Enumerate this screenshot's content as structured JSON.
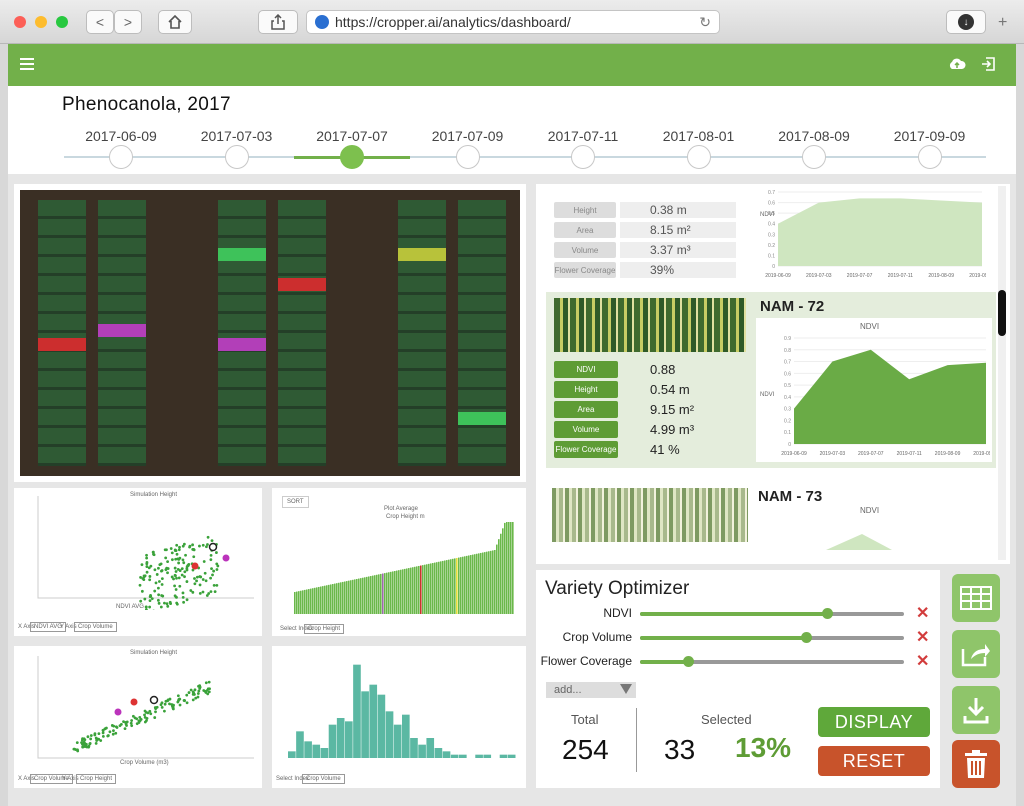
{
  "browser": {
    "url": "https://cropper.ai/analytics/dashboard/",
    "nav_back": "<",
    "nav_forward": ">",
    "home_icon": "home-icon",
    "share_icon": "share-icon",
    "download_icon": "download-icon",
    "new_tab": "+"
  },
  "app": {
    "menu_icon": "hamburger-icon",
    "upload_icon": "cloud-upload-icon",
    "logout_icon": "logout-icon",
    "title": "Phenocanola, 2017",
    "accent": "#72b04a",
    "dates": [
      "2017-06-09",
      "2017-07-03",
      "2017-07-07",
      "2017-07-09",
      "2017-07-11",
      "2017-08-01",
      "2017-08-09",
      "2017-09-09"
    ],
    "selected_date_index": 2
  },
  "nam_prev": {
    "metrics": [
      {
        "label": "Height",
        "value": "0.38 m"
      },
      {
        "label": "Area",
        "value": "8.15 m²"
      },
      {
        "label": "Volume",
        "value": "3.37 m³"
      },
      {
        "label": "Flower Coverage",
        "value": "39%"
      }
    ],
    "legend": "NDVI",
    "xticks": [
      "2019-06-09",
      "2019-07-03",
      "2019-07-07",
      "2019-07-11",
      "2019-08-09",
      "2019-09-09"
    ],
    "yticks": [
      "0.7",
      "0.6",
      "0.5",
      "0.4",
      "0.3",
      "0.2",
      "0.1",
      "0"
    ]
  },
  "nam72": {
    "name": "NAM - 72",
    "chart_title": "NDVI",
    "legend": "NDVI",
    "metrics": [
      {
        "label": "NDVI",
        "value": "0.88"
      },
      {
        "label": "Height",
        "value": "0.54 m"
      },
      {
        "label": "Area",
        "value": "9.15 m²"
      },
      {
        "label": "Volume",
        "value": "4.99 m³"
      },
      {
        "label": "Flower Coverage",
        "value": "41 %"
      }
    ],
    "xticks": [
      "2019-06-09",
      "2019-07-03",
      "2019-07-07",
      "2019-07-11",
      "2019-08-09",
      "2019-09-09"
    ],
    "yticks": [
      "0.9",
      "0.8",
      "0.7",
      "0.6",
      "0.5",
      "0.4",
      "0.3",
      "0.2",
      "0.1",
      "0"
    ]
  },
  "nam73": {
    "name": "NAM - 73",
    "chart_title": "NDVI"
  },
  "mini_charts": {
    "scatter1": {
      "legend": "Simulation Height",
      "ylabel": "Crop Height (m)",
      "xlabel": "NDVI AVG",
      "x_axis_label": "X Axis",
      "x_axis_value": "NDVI AVG",
      "y_axis_label": "Y Axis",
      "y_axis_value": "Crop Volume"
    },
    "bars": {
      "legend": "Crop Height m",
      "title": "Plot Average",
      "button": "SORT",
      "ylabel": "Crop Height (m)",
      "select_label": "Select Index",
      "select_value": "Crop Height"
    },
    "scatter2": {
      "legend": "Simulation Height",
      "ylabel": "Crop Height (m)",
      "xlabel": "Crop Volume (m3)",
      "x_axis_label": "X Axis",
      "x_axis_value": "Crop Volume",
      "y_axis_label": "Y Axis",
      "y_axis_value": "Crop Height"
    },
    "hist": {
      "ylabel": "Crop Volume (m3)",
      "select_label": "Select Index",
      "select_value": "Crop Volume"
    }
  },
  "optimizer": {
    "title": "Variety Optimizer",
    "sliders": [
      {
        "label": "NDVI",
        "value": 0.71
      },
      {
        "label": "Crop Volume",
        "value": 0.63
      },
      {
        "label": "Flower Coverage",
        "value": 0.18
      }
    ],
    "add_placeholder": "add...",
    "total_label": "Total",
    "total": "254",
    "selected_label": "Selected",
    "selected": "33",
    "percent": "13%",
    "display_button": "DISPLAY",
    "reset_button": "RESET",
    "actions": [
      "table-icon",
      "share-icon",
      "download-icon",
      "trash-icon"
    ]
  },
  "colors": {
    "green": "#72b04a",
    "red": "#c8532b",
    "sidebar_green": "#8fc56a",
    "trash": "#c8532b"
  },
  "chart_data": [
    {
      "type": "area",
      "title": "NDVI",
      "series": [
        {
          "name": "NDVI",
          "values": [
            0.3,
            0.7,
            0.8,
            0.55,
            0.67,
            0.69
          ]
        }
      ],
      "categories": [
        "2019-06-09",
        "2019-07-03",
        "2019-07-07",
        "2019-07-11",
        "2019-08-09",
        "2019-09-09"
      ],
      "ylim": [
        0,
        0.9
      ]
    },
    {
      "type": "area",
      "series": [
        {
          "name": "NDVI",
          "values": [
            0.4,
            0.6,
            0.64,
            0.64,
            0.62,
            0.6
          ]
        }
      ],
      "categories": [
        "2019-06-09",
        "2019-07-03",
        "2019-07-07",
        "2019-07-11",
        "2019-08-09",
        "2019-09-09"
      ],
      "ylim": [
        0,
        0.7
      ]
    },
    {
      "type": "bar",
      "title": "",
      "series": [
        {
          "name": "Volume",
          "values": [
            2,
            8,
            5,
            4,
            3,
            10,
            12,
            11,
            28,
            20,
            22,
            19,
            14,
            10,
            13,
            6,
            4,
            6,
            3,
            2,
            1,
            1,
            0,
            1,
            1,
            0,
            1,
            1
          ]
        }
      ],
      "ylim": [
        0,
        30
      ]
    }
  ]
}
